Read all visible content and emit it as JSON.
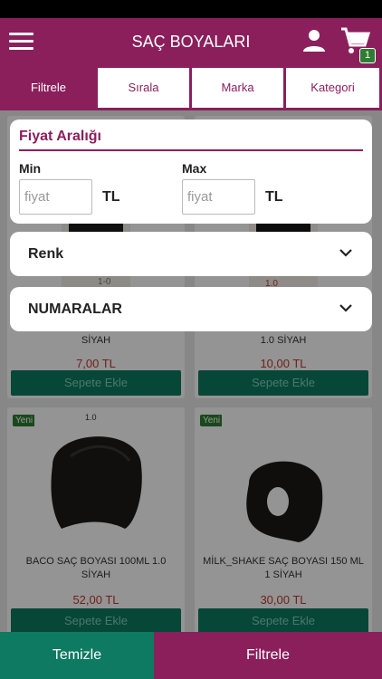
{
  "app_bar": {
    "title": "SAÇ BOYALARI",
    "cart_count": "1"
  },
  "tabs": [
    {
      "label": "Filtrele",
      "active": true
    },
    {
      "label": "Sırala",
      "active": false
    },
    {
      "label": "Marka",
      "active": false
    },
    {
      "label": "Kategori",
      "active": false
    }
  ],
  "price_filter": {
    "title": "Fiyat Aralığı",
    "min_label": "Min",
    "max_label": "Max",
    "min_placeholder": "fiyat",
    "max_placeholder": "fiyat",
    "currency": "TL"
  },
  "accordions": [
    {
      "label": "Renk"
    },
    {
      "label": "NUMARALAR"
    }
  ],
  "products": [
    {
      "name": "SİYAH",
      "price": "7,00 TL",
      "button": "Sepete Ekle",
      "shade_code": "1-0",
      "badge": ""
    },
    {
      "name": "1.0 SİYAH",
      "price": "10,00 TL",
      "button": "Sepete Ekle",
      "shade_code": "1.0",
      "badge": ""
    },
    {
      "name": "BACO SAÇ BOYASI 100ML 1.0 SİYAH",
      "price": "52,00 TL",
      "button": "Sepete Ekle",
      "shade_code": "1.0",
      "badge": "Yeni"
    },
    {
      "name": "MİLK_SHAKE SAÇ BOYASI 150 ML 1 SİYAH",
      "price": "30,00 TL",
      "button": "Sepete Ekle",
      "shade_code": "",
      "badge": "Yeni"
    }
  ],
  "bottom": {
    "clear_label": "Temizle",
    "filter_label": "Filtrele"
  },
  "colors": {
    "brand": "#8b1f5c",
    "green": "#0d7a61",
    "price_red": "#c0392b"
  }
}
